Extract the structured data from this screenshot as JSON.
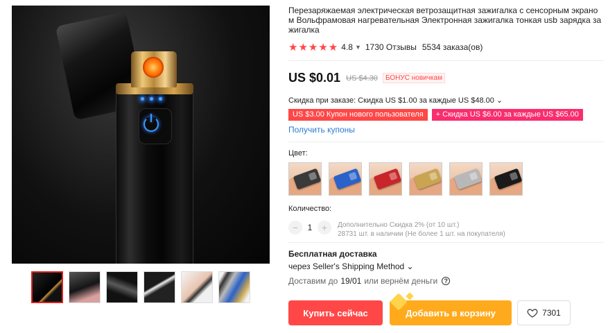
{
  "product": {
    "title": "Перезаряжаемая электрическая ветрозащитная зажигалка с сенсорным экрано м Вольфрамовая нагревательная Электронная зажигалка тонкая usb зарядка за жигалка",
    "stars": "★★★★★",
    "rating": "4.8",
    "reviews": "1730 Отзывы",
    "orders": "5534 заказа(ов)"
  },
  "price": {
    "current": "US $0.01",
    "old": "US $4.30",
    "bonus": "БОНУС новичкам"
  },
  "discount": {
    "line": "Скидка при заказе: Скидка US $1.00 за каждые US $48.00 ⌄",
    "coupons": [
      "US $3.00 Купон нового пользователя",
      "+ Скидка US $6.00 за каждые US $65.00"
    ],
    "get_coupons": "Получить купоны"
  },
  "color": {
    "label": "Цвет:",
    "options": [
      {
        "name": "black-silver",
        "color": "#3a3a3a"
      },
      {
        "name": "blue",
        "color": "#2a62c9"
      },
      {
        "name": "red",
        "color": "#c8262a"
      },
      {
        "name": "gold",
        "color": "#c9a552"
      },
      {
        "name": "silver",
        "color": "#b8b8b8"
      },
      {
        "name": "black",
        "color": "#1a1a1a"
      }
    ]
  },
  "quantity": {
    "label": "Количество:",
    "minus": "−",
    "value": "1",
    "plus": "+",
    "note1": "Дополнительно Скидка 2% (от 10 шт.)",
    "note2": "28731 шт. в наличии (Не более 1 шт. на покупателя)"
  },
  "shipping": {
    "title": "Бесплатная доставка",
    "method": "через Seller's Shipping Method ⌄",
    "deliver_prefix": "Доставим до",
    "deliver_date": "19/01",
    "deliver_suffix": "или вернём деньги",
    "help_icon": "?"
  },
  "actions": {
    "buy": "Купить сейчас",
    "cart": "Добавить в корзину",
    "wishlist_count": "7301"
  },
  "colors": {
    "accent_red": "#ff4747",
    "cart_orange": "#ffaa1c",
    "link_blue": "#2e7ad1",
    "coupon_pink": "#fa2d6e"
  }
}
